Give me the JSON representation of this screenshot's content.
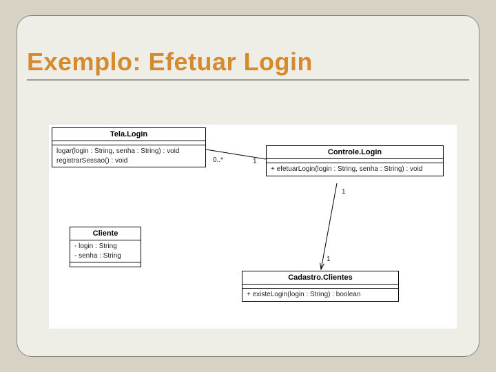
{
  "slide": {
    "title": "Exemplo: Efetuar Login"
  },
  "classes": {
    "telaLogin": {
      "name": "Tela.Login",
      "attrs": [],
      "ops": [
        "logar(login : String, senha : String) : void",
        "registrarSessao() : void"
      ]
    },
    "controleLogin": {
      "name": "Controle.Login",
      "attrs": [],
      "ops": [
        "+ efetuarLogin(login : String, senha : String) : void"
      ]
    },
    "cliente": {
      "name": "Cliente",
      "attrs": [
        "- login : String",
        "- senha : String"
      ],
      "ops": []
    },
    "cadastroClientes": {
      "name": "Cadastro.Clientes",
      "attrs": [],
      "ops": [
        "+ existeLogin(login : String) : boolean"
      ]
    }
  },
  "assoc": {
    "tela_ctrl_left": "0..*",
    "tela_ctrl_right": "1",
    "ctrl_cad_top": "1",
    "ctrl_cad_bottom": "1"
  }
}
